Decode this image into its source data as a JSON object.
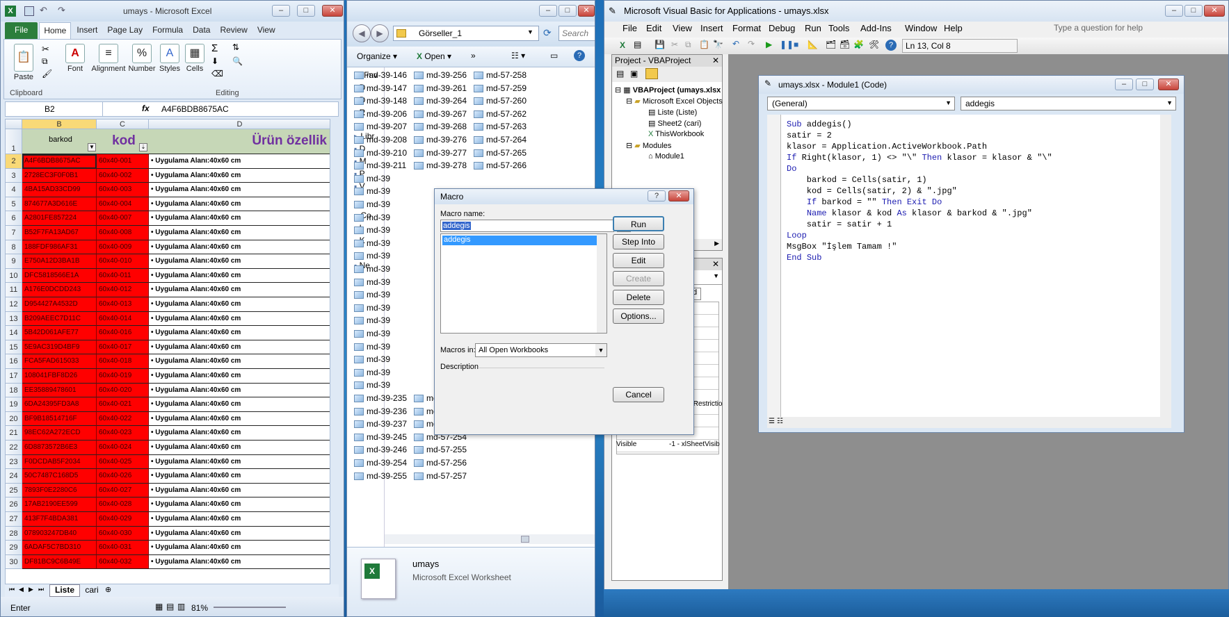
{
  "excel": {
    "title": "umays - Microsoft Excel",
    "tabs": [
      "File",
      "Home",
      "Insert",
      "Page Lay",
      "Formula",
      "Data",
      "Review",
      "View"
    ],
    "groups": {
      "paste": "Paste",
      "clipboard": "Clipboard",
      "font": "Font",
      "alignment": "Alignment",
      "number": "Number",
      "styles": "Styles",
      "cells": "Cells",
      "editing": "Editing"
    },
    "namebox": "B2",
    "fx": "fx",
    "formula": "A4F6BDB8675AC",
    "cols": [
      "B",
      "C",
      "D"
    ],
    "header": {
      "b": "barkod",
      "c": "kod",
      "d": "Ürün özellik"
    },
    "rows": [
      {
        "n": "2",
        "b": "A4F6BDB8675AC",
        "c": "60x40-001",
        "d": "• Uygulama Alanı:40x60 cm"
      },
      {
        "n": "3",
        "b": "2728EC3F0F0B1",
        "c": "60x40-002",
        "d": "• Uygulama Alanı:40x60 cm"
      },
      {
        "n": "4",
        "b": "4BA15AD33CD99",
        "c": "60x40-003",
        "d": "• Uygulama Alanı:40x60 cm"
      },
      {
        "n": "5",
        "b": "874677A3D616E",
        "c": "60x40-004",
        "d": "• Uygulama Alanı:40x60 cm"
      },
      {
        "n": "6",
        "b": "A2801FE857224",
        "c": "60x40-007",
        "d": "• Uygulama Alanı:40x60 cm"
      },
      {
        "n": "7",
        "b": "B52F7FA13AD67",
        "c": "60x40-008",
        "d": "• Uygulama Alanı:40x60 cm"
      },
      {
        "n": "8",
        "b": "188FDF986AF31",
        "c": "60x40-009",
        "d": "• Uygulama Alanı:40x60 cm"
      },
      {
        "n": "9",
        "b": "E750A12D3BA1B",
        "c": "60x40-010",
        "d": "• Uygulama Alanı:40x60 cm"
      },
      {
        "n": "10",
        "b": "DFC5818566E1A",
        "c": "60x40-011",
        "d": "• Uygulama Alanı:40x60 cm"
      },
      {
        "n": "11",
        "b": "A176E0DCDD243",
        "c": "60x40-012",
        "d": "• Uygulama Alanı:40x60 cm"
      },
      {
        "n": "12",
        "b": "D954427A4532D",
        "c": "60x40-013",
        "d": "• Uygulama Alanı:40x60 cm"
      },
      {
        "n": "13",
        "b": "B209AEEC7D11C",
        "c": "60x40-014",
        "d": "• Uygulama Alanı:40x60 cm"
      },
      {
        "n": "14",
        "b": "5B42D061AFE77",
        "c": "60x40-016",
        "d": "• Uygulama Alanı:40x60 cm"
      },
      {
        "n": "15",
        "b": "5E9AC319D4BF9",
        "c": "60x40-017",
        "d": "• Uygulama Alanı:40x60 cm"
      },
      {
        "n": "16",
        "b": "FCA5FAD615033",
        "c": "60x40-018",
        "d": "• Uygulama Alanı:40x60 cm"
      },
      {
        "n": "17",
        "b": "108041FBF8D26",
        "c": "60x40-019",
        "d": "• Uygulama Alanı:40x60 cm"
      },
      {
        "n": "18",
        "b": "EE35889478601",
        "c": "60x40-020",
        "d": "• Uygulama Alanı:40x60 cm"
      },
      {
        "n": "19",
        "b": "6DA24395FD3A8",
        "c": "60x40-021",
        "d": "• Uygulama Alanı:40x60 cm"
      },
      {
        "n": "20",
        "b": "BF9B18514716F",
        "c": "60x40-022",
        "d": "• Uygulama Alanı:40x60 cm"
      },
      {
        "n": "21",
        "b": "98EC62A272ECD",
        "c": "60x40-023",
        "d": "• Uygulama Alanı:40x60 cm"
      },
      {
        "n": "22",
        "b": "6D8873572B6E3",
        "c": "60x40-024",
        "d": "• Uygulama Alanı:40x60 cm"
      },
      {
        "n": "23",
        "b": "F0DCDAB5F2034",
        "c": "60x40-025",
        "d": "• Uygulama Alanı:40x60 cm"
      },
      {
        "n": "24",
        "b": "50C7487C168D5",
        "c": "60x40-026",
        "d": "• Uygulama Alanı:40x60 cm"
      },
      {
        "n": "25",
        "b": "7893F0E2280C6",
        "c": "60x40-027",
        "d": "• Uygulama Alanı:40x60 cm"
      },
      {
        "n": "26",
        "b": "17AB2190EE599",
        "c": "60x40-028",
        "d": "• Uygulama Alanı:40x60 cm"
      },
      {
        "n": "27",
        "b": "413F7F4BDA381",
        "c": "60x40-029",
        "d": "• Uygulama Alanı:40x60 cm"
      },
      {
        "n": "28",
        "b": "078903247DB40",
        "c": "60x40-030",
        "d": "• Uygulama Alanı:40x60 cm"
      },
      {
        "n": "29",
        "b": "6ADAF5C7BD310",
        "c": "60x40-031",
        "d": "• Uygulama Alanı:40x60 cm"
      },
      {
        "n": "30",
        "b": "DF81BC9C6B49E",
        "c": "60x40-032",
        "d": "• Uygulama Alanı:40x60 cm"
      }
    ],
    "sheets": [
      "Liste",
      "cari"
    ],
    "status": "Enter",
    "zoom": "81%"
  },
  "explorer": {
    "path": "Görseller_1",
    "search": "Search",
    "organize": "Organize",
    "open": "Open",
    "nav": [
      "Fav",
      "D",
      "D",
      "R",
      "Libr",
      "D",
      "M",
      "P",
      "V",
      "Co",
      "L",
      "K",
      "Ne"
    ],
    "col1": [
      "md-39-146",
      "md-39-147",
      "md-39-148",
      "md-39-206",
      "md-39-207",
      "md-39-208",
      "md-39-210",
      "md-39-211",
      "md-39",
      "md-39",
      "md-39",
      "md-39",
      "md-39",
      "md-39",
      "md-39",
      "md-39",
      "md-39",
      "md-39",
      "md-39",
      "md-39",
      "md-39",
      "md-39",
      "md-39",
      "md-39",
      "md-39",
      "md-39-235",
      "md-39-236",
      "md-39-237",
      "md-39-245",
      "md-39-246",
      "md-39-254",
      "md-39-255"
    ],
    "col2": [
      "md-39-256",
      "md-39-261",
      "md-39-264",
      "md-39-267",
      "md-39-268",
      "md-39-276",
      "md-39-277",
      "md-39-278",
      "md-57-249",
      "md-57-250",
      "md-57-253",
      "md-57-254",
      "md-57-255",
      "md-57-256",
      "md-57-257"
    ],
    "col3": [
      "md-57-258",
      "md-57-259",
      "md-57-260",
      "md-57-262",
      "md-57-263",
      "md-57-264",
      "md-57-265",
      "md-57-266"
    ],
    "detail_name": "umays",
    "detail_type": "Microsoft Excel Worksheet"
  },
  "vba": {
    "title": "Microsoft Visual Basic for Applications - umays.xlsx",
    "menus": [
      "File",
      "Edit",
      "View",
      "Insert",
      "Format",
      "Debug",
      "Run",
      "Tools",
      "Add-Ins",
      "Window",
      "Help"
    ],
    "help_placeholder": "Type a question for help",
    "position": "Ln 13, Col 8",
    "project_title": "Project - VBAProject",
    "tree": [
      "VBAProject (umays.xlsx",
      "Microsoft Excel Objects",
      "Liste (Liste)",
      "Sheet2 (cari)",
      "ThisWorkbook",
      "Modules",
      "Module1"
    ],
    "props": {
      "r1": "NoRestrictio",
      "name": "Visible",
      "value": "-1 - xlSheetVisib",
      "tab": "d"
    },
    "code_title": "umays.xlsx - Module1 (Code)",
    "combo_left": "(General)",
    "combo_right": "addegis",
    "code": [
      "Sub addegis()",
      "satir = 2",
      "klasor = Application.ActiveWorkbook.Path",
      "If Right(klasor, 1) <> \"\\\" Then klasor = klasor & \"\\\"",
      "Do",
      "    barkod = Cells(satir, 1)",
      "    kod = Cells(satir, 2) & \".jpg\"",
      "    If barkod = \"\" Then Exit Do",
      "    Name klasor & kod As klasor & barkod & \".jpg\"",
      "    satir = satir + 1",
      "Loop",
      "MsgBox \"İşlem Tamam !\"",
      "End Sub"
    ]
  },
  "dialog": {
    "title": "Macro",
    "name_label": "Macro name:",
    "name_value": "addegis",
    "list": [
      "addegis"
    ],
    "buttons": [
      "Run",
      "Step Into",
      "Edit",
      "Create",
      "Delete",
      "Options...",
      "Cancel"
    ],
    "macros_in_label": "Macros in:",
    "macros_in_value": "All Open Workbooks",
    "description_label": "Description"
  }
}
